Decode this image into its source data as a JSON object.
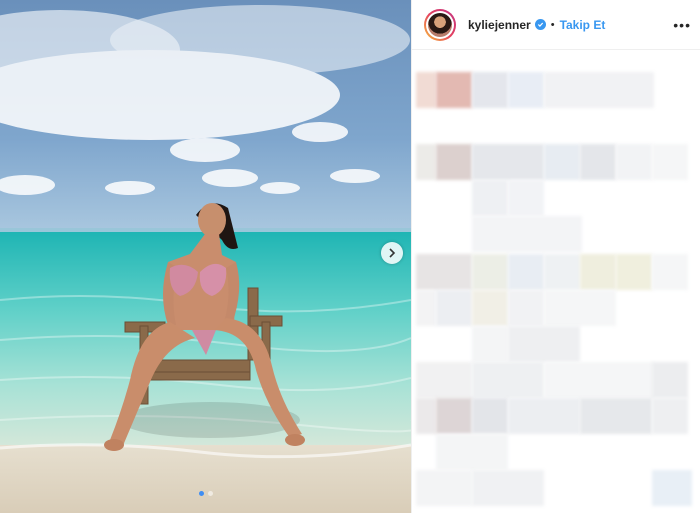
{
  "post": {
    "username": "kyliejenner",
    "separator": "•",
    "follow_label": "Takip Et",
    "more_label": "•••",
    "verified": true
  },
  "media": {
    "carousel_total": 2,
    "carousel_current": 1,
    "next_icon": "chevron-right-icon"
  },
  "colors": {
    "accent": "#3897f0",
    "sky": "#5f89b8",
    "sea": "#40c9c4",
    "sand": "#e6dccd"
  }
}
